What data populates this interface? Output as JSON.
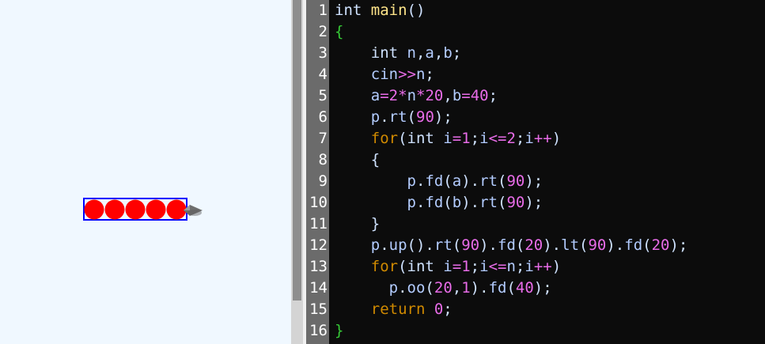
{
  "editor": {
    "line_numbers": [
      "1",
      "2",
      "3",
      "4",
      "5",
      "6",
      "7",
      "8",
      "9",
      "10",
      "11",
      "12",
      "13",
      "14",
      "15",
      "16"
    ],
    "lines": [
      [
        {
          "t": "int ",
          "c": "ty"
        },
        {
          "t": "main",
          "c": "fn"
        },
        {
          "t": "()",
          "c": "pu"
        }
      ],
      [
        {
          "t": "{",
          "c": "br"
        }
      ],
      [
        {
          "t": "    int ",
          "c": "ty"
        },
        {
          "t": "n",
          "c": "id"
        },
        {
          "t": ",",
          "c": "pu"
        },
        {
          "t": "a",
          "c": "id"
        },
        {
          "t": ",",
          "c": "pu"
        },
        {
          "t": "b",
          "c": "id"
        },
        {
          "t": ";",
          "c": "pu"
        }
      ],
      [
        {
          "t": "    cin",
          "c": "id"
        },
        {
          "t": ">>",
          "c": "op"
        },
        {
          "t": "n",
          "c": "id"
        },
        {
          "t": ";",
          "c": "pu"
        }
      ],
      [
        {
          "t": "    a",
          "c": "id"
        },
        {
          "t": "=",
          "c": "op"
        },
        {
          "t": "2",
          "c": "num"
        },
        {
          "t": "*",
          "c": "op"
        },
        {
          "t": "n",
          "c": "id"
        },
        {
          "t": "*",
          "c": "op"
        },
        {
          "t": "20",
          "c": "num"
        },
        {
          "t": ",",
          "c": "pu"
        },
        {
          "t": "b",
          "c": "id"
        },
        {
          "t": "=",
          "c": "op"
        },
        {
          "t": "40",
          "c": "num"
        },
        {
          "t": ";",
          "c": "pu"
        }
      ],
      [
        {
          "t": "    p",
          "c": "id"
        },
        {
          "t": ".",
          "c": "pu"
        },
        {
          "t": "rt",
          "c": "id"
        },
        {
          "t": "(",
          "c": "pu"
        },
        {
          "t": "90",
          "c": "num"
        },
        {
          "t": ");",
          "c": "pu"
        }
      ],
      [
        {
          "t": "    for",
          "c": "kw"
        },
        {
          "t": "(",
          "c": "pu"
        },
        {
          "t": "int ",
          "c": "ty"
        },
        {
          "t": "i",
          "c": "id"
        },
        {
          "t": "=",
          "c": "op"
        },
        {
          "t": "1",
          "c": "num"
        },
        {
          "t": ";",
          "c": "pu"
        },
        {
          "t": "i",
          "c": "id"
        },
        {
          "t": "<=",
          "c": "op"
        },
        {
          "t": "2",
          "c": "num"
        },
        {
          "t": ";",
          "c": "pu"
        },
        {
          "t": "i",
          "c": "id"
        },
        {
          "t": "++",
          "c": "op"
        },
        {
          "t": ")",
          "c": "pu"
        }
      ],
      [
        {
          "t": "    {",
          "c": "pu"
        }
      ],
      [
        {
          "t": "        p",
          "c": "id"
        },
        {
          "t": ".",
          "c": "pu"
        },
        {
          "t": "fd",
          "c": "id"
        },
        {
          "t": "(",
          "c": "pu"
        },
        {
          "t": "a",
          "c": "id"
        },
        {
          "t": ").",
          "c": "pu"
        },
        {
          "t": "rt",
          "c": "id"
        },
        {
          "t": "(",
          "c": "pu"
        },
        {
          "t": "90",
          "c": "num"
        },
        {
          "t": ");",
          "c": "pu"
        }
      ],
      [
        {
          "t": "        p",
          "c": "id"
        },
        {
          "t": ".",
          "c": "pu"
        },
        {
          "t": "fd",
          "c": "id"
        },
        {
          "t": "(",
          "c": "pu"
        },
        {
          "t": "b",
          "c": "id"
        },
        {
          "t": ").",
          "c": "pu"
        },
        {
          "t": "rt",
          "c": "id"
        },
        {
          "t": "(",
          "c": "pu"
        },
        {
          "t": "90",
          "c": "num"
        },
        {
          "t": ");",
          "c": "pu"
        }
      ],
      [
        {
          "t": "    }",
          "c": "pu"
        }
      ],
      [
        {
          "t": "    p",
          "c": "id"
        },
        {
          "t": ".",
          "c": "pu"
        },
        {
          "t": "up",
          "c": "id"
        },
        {
          "t": "().",
          "c": "pu"
        },
        {
          "t": "rt",
          "c": "id"
        },
        {
          "t": "(",
          "c": "pu"
        },
        {
          "t": "90",
          "c": "num"
        },
        {
          "t": ").",
          "c": "pu"
        },
        {
          "t": "fd",
          "c": "id"
        },
        {
          "t": "(",
          "c": "pu"
        },
        {
          "t": "20",
          "c": "num"
        },
        {
          "t": ").",
          "c": "pu"
        },
        {
          "t": "lt",
          "c": "id"
        },
        {
          "t": "(",
          "c": "pu"
        },
        {
          "t": "90",
          "c": "num"
        },
        {
          "t": ").",
          "c": "pu"
        },
        {
          "t": "fd",
          "c": "id"
        },
        {
          "t": "(",
          "c": "pu"
        },
        {
          "t": "20",
          "c": "num"
        },
        {
          "t": ");",
          "c": "pu"
        }
      ],
      [
        {
          "t": "    for",
          "c": "kw"
        },
        {
          "t": "(",
          "c": "pu"
        },
        {
          "t": "int ",
          "c": "ty"
        },
        {
          "t": "i",
          "c": "id"
        },
        {
          "t": "=",
          "c": "op"
        },
        {
          "t": "1",
          "c": "num"
        },
        {
          "t": ";",
          "c": "pu"
        },
        {
          "t": "i",
          "c": "id"
        },
        {
          "t": "<=",
          "c": "op"
        },
        {
          "t": "n",
          "c": "id"
        },
        {
          "t": ";",
          "c": "pu"
        },
        {
          "t": "i",
          "c": "id"
        },
        {
          "t": "++",
          "c": "op"
        },
        {
          "t": ")",
          "c": "pu"
        }
      ],
      [
        {
          "t": "      p",
          "c": "id"
        },
        {
          "t": ".",
          "c": "pu"
        },
        {
          "t": "oo",
          "c": "id"
        },
        {
          "t": "(",
          "c": "pu"
        },
        {
          "t": "20",
          "c": "num"
        },
        {
          "t": ",",
          "c": "pu"
        },
        {
          "t": "1",
          "c": "num"
        },
        {
          "t": ").",
          "c": "pu"
        },
        {
          "t": "fd",
          "c": "id"
        },
        {
          "t": "(",
          "c": "pu"
        },
        {
          "t": "40",
          "c": "num"
        },
        {
          "t": ");",
          "c": "pu"
        }
      ],
      [
        {
          "t": "    return ",
          "c": "kw"
        },
        {
          "t": "0",
          "c": "num"
        },
        {
          "t": ";",
          "c": "pu"
        }
      ],
      [
        {
          "t": "}",
          "c": "br"
        }
      ]
    ]
  },
  "canvas": {
    "circle_count": 5,
    "circle_color": "#ff0000",
    "rect_color": "#0000ff",
    "background": "#f0f8ff"
  }
}
